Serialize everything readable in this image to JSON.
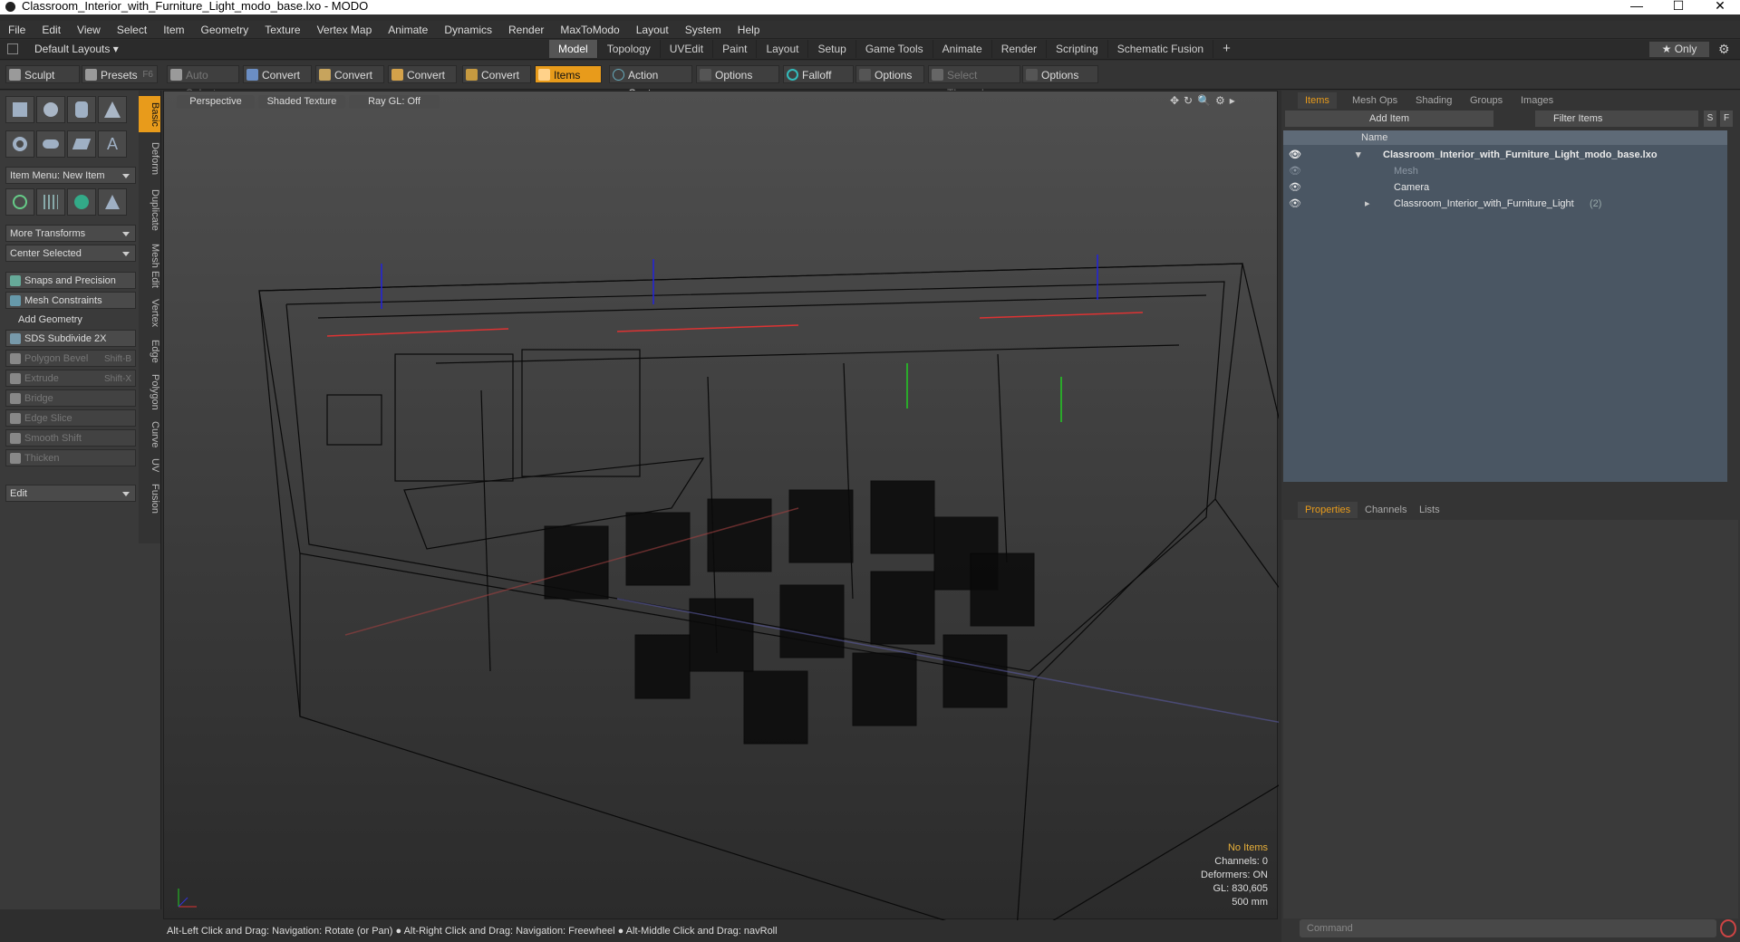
{
  "window": {
    "title": "Classroom_Interior_with_Furniture_Light_modo_base.lxo - MODO",
    "min": "—",
    "max": "☐",
    "close": "✕"
  },
  "menu": [
    "File",
    "Edit",
    "View",
    "Select",
    "Item",
    "Geometry",
    "Texture",
    "Vertex Map",
    "Animate",
    "Dynamics",
    "Render",
    "MaxToModo",
    "Layout",
    "System",
    "Help"
  ],
  "layout": {
    "selector": "Default Layouts ▾",
    "tabs": [
      "Model",
      "Topology",
      "UVEdit",
      "Paint",
      "Layout",
      "Setup",
      "Game Tools",
      "Animate",
      "Render",
      "Scripting",
      "Schematic Fusion"
    ],
    "add": "+",
    "only": "★ Only"
  },
  "toolbar": {
    "sculpt": "Sculpt",
    "presets": "Presets",
    "presets_key": "F6",
    "auto_select": "Auto Select",
    "convert": "Convert",
    "items": "Items",
    "action_center": "Action Center",
    "options": "Options",
    "falloff": "Falloff",
    "select_through": "Select Through"
  },
  "left": {
    "vtabs": [
      "Basic",
      "Deform",
      "Duplicate",
      "Mesh Edit",
      "Vertex",
      "Edge",
      "Polygon",
      "Curve",
      "UV",
      "Fusion"
    ],
    "item_menu": "Item Menu: New Item",
    "more_transforms": "More Transforms",
    "center_selected": "Center Selected",
    "snaps": "Snaps and Precision",
    "mesh_constraints": "Mesh Constraints",
    "add_geometry": "Add Geometry",
    "sds": "SDS Subdivide 2X",
    "polygon_bevel": "Polygon Bevel",
    "polygon_bevel_key": "Shift-B",
    "extrude": "Extrude",
    "extrude_key": "Shift-X",
    "bridge": "Bridge",
    "edge_slice": "Edge Slice",
    "smooth_shift": "Smooth Shift",
    "thicken": "Thicken",
    "edit": "Edit"
  },
  "viewport": {
    "perspective": "Perspective",
    "shading": "Shaded Texture",
    "raygl": "Ray GL: Off",
    "info": {
      "no_items": "No Items",
      "channels": "Channels: 0",
      "deformers": "Deformers: ON",
      "gl": "GL: 830,605",
      "scale": "500 mm"
    }
  },
  "status": "Alt-Left Click and Drag: Navigation: Rotate (or Pan) ● Alt-Right Click and Drag: Navigation: Freewheel ● Alt-Middle Click and Drag: navRoll",
  "right": {
    "tabs": [
      "Items",
      "Mesh Ops",
      "Shading",
      "Groups",
      "Images"
    ],
    "add_item": "Add Item",
    "filter": "Filter Items",
    "s": "S",
    "f": "F",
    "name_col": "Name",
    "items": [
      {
        "label": "Classroom_Interior_with_Furniture_Light_modo_base.lxo",
        "bold": true
      },
      {
        "label": "Mesh",
        "dim": true
      },
      {
        "label": "Camera"
      },
      {
        "label": "Classroom_Interior_with_Furniture_Light",
        "suffix": "(2)"
      }
    ],
    "bottom_tabs": [
      "Properties",
      "Channels",
      "Lists"
    ],
    "command": "Command"
  },
  "colors": {
    "accent": "#e89b1b",
    "list_bg": "#4a5663"
  }
}
